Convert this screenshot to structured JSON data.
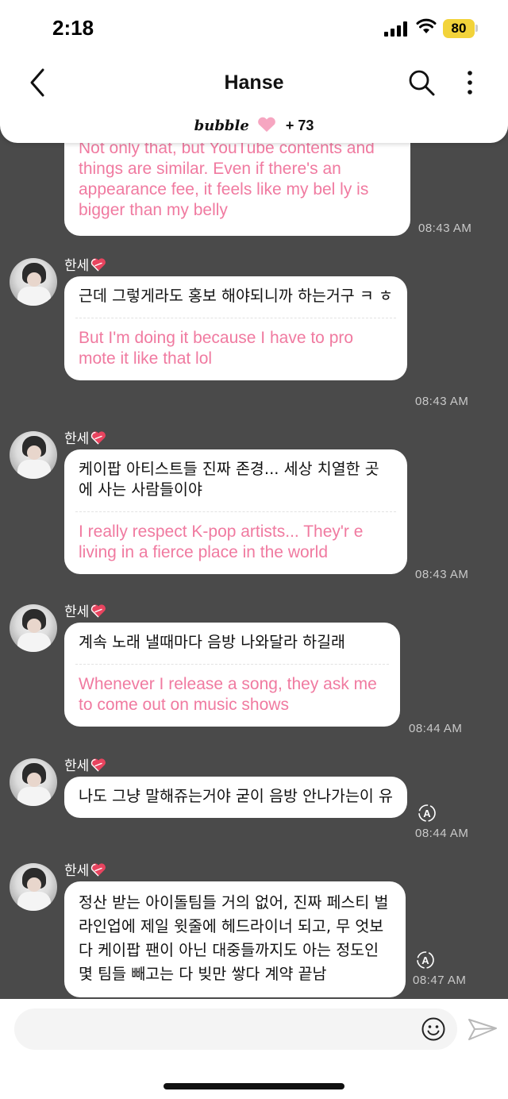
{
  "status_bar": {
    "time": "2:18",
    "battery": "80"
  },
  "header": {
    "title": "Hanse",
    "brand": "bubble",
    "subscriber_count": "+ 73"
  },
  "messages": [
    {
      "sender": "",
      "ko": "",
      "en": "Not only that, but YouTube contents and things are similar. Even if there's an appearance fee, it feels like my bel ly is bigger than my belly",
      "time": "08:43 AM"
    },
    {
      "sender": "한세",
      "ko": "근데 그렇게라도 홍보 해야되니까 하는거구 ㅋ ㅎ",
      "en": "But I'm doing it because I have to pro mote it like that lol",
      "time": "08:43 AM"
    },
    {
      "sender": "한세",
      "ko": "케이팝 아티스트들 진짜 존경... 세상 치열한 곳에 사는 사람들이야",
      "en": "I really respect K-pop artists... They'r e living in a fierce place in the world",
      "time": "08:43 AM"
    },
    {
      "sender": "한세",
      "ko": "계속 노래 낼때마다 음방 나와달라 하길래",
      "en": "Whenever I release a song, they ask me to come out on music shows",
      "time": "08:44 AM"
    },
    {
      "sender": "한세",
      "ko": "나도 그냥 말해쥬는거야 굳이 음방 안나가는이 유",
      "en": "",
      "time": "08:44 AM"
    },
    {
      "sender": "한세",
      "ko": "정산 받는 아이돌팀들 거의 없어, 진짜 페스티 벌 라인업에 제일 윗줄에 헤드라이너 되고, 무 엇보다 케이팝 팬이 아닌 대중들까지도 아는 정도인 몇 팀들 빼고는 다 빚만 쌓다 계약 끝남",
      "en": "",
      "time": "08:47 AM"
    }
  ],
  "composer": {
    "placeholder": ""
  },
  "colors": {
    "background": "#4a4a4a",
    "translation_text": "#f07aa0",
    "battery": "#f2d33a"
  }
}
